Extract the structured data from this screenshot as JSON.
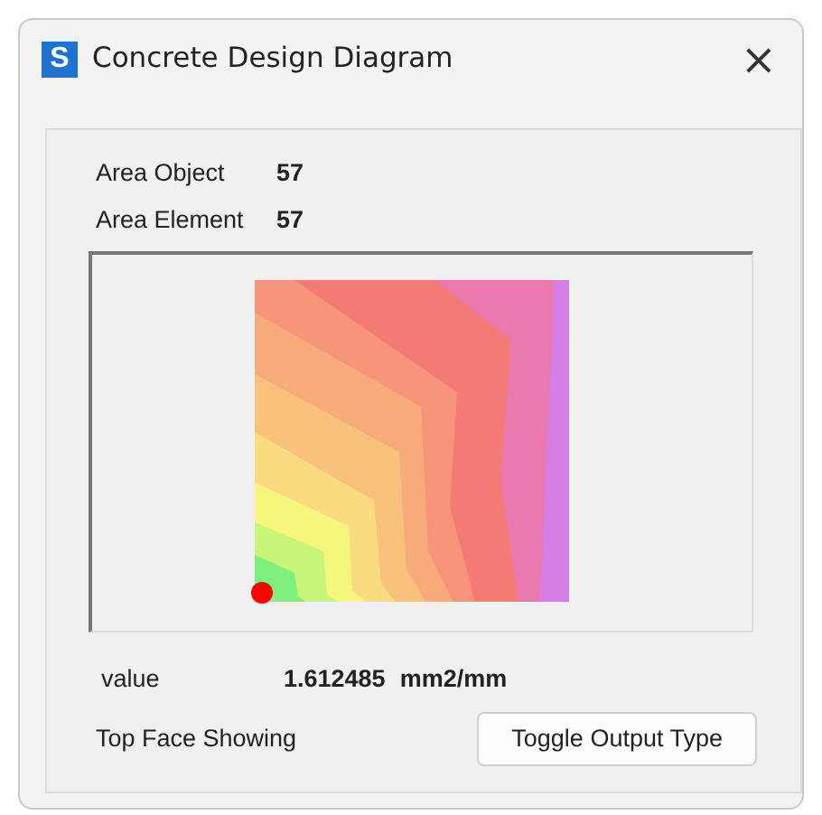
{
  "window": {
    "title": "Concrete Design Diagram",
    "app_icon": "S",
    "close": "×"
  },
  "info": [
    {
      "label": "Area Object",
      "value": "57"
    },
    {
      "label": "Area Element",
      "value": "57"
    }
  ],
  "result": {
    "label": "value",
    "value": "1.612485",
    "unit": "mm2/mm"
  },
  "face_status": "Top Face Showing",
  "buttons": [
    "Toggle Output Type"
  ]
}
